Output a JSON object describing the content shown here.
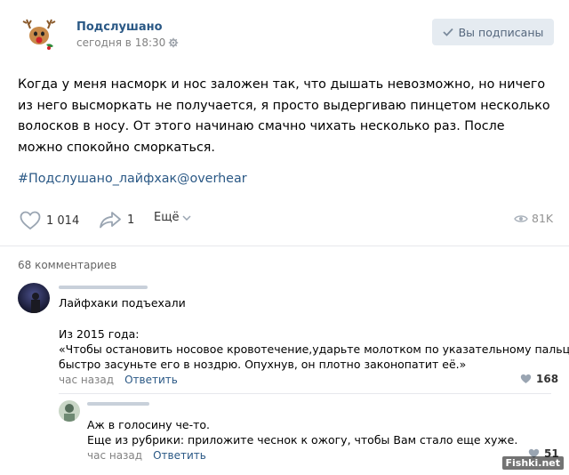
{
  "post": {
    "author": "Подслушано",
    "time": "сегодня в 18:30",
    "subscribe_label": "Вы подписаны",
    "text": "Когда у меня насморк и нос заложен так, что дышать невозможно, но ничего из него высморкать не получается, я просто выдергиваю пинцетом несколько волосков в носу. От этого начинаю смачно чихать несколько раз. После можно спокойно сморкаться.",
    "hashtag": "#Подслушано_лайфхак@overhear",
    "likes": "1 014",
    "shares": "1",
    "more_label": "Ещё",
    "views": "81K"
  },
  "comments": {
    "count_label": "68 комментариев",
    "items": [
      {
        "lines": [
          "Лайфхаки подъехали",
          "",
          "Из 2015 года:",
          "«Чтобы остановить носовое кровотечение,ударьте молотком по указательному пальцу, и",
          "быстро засуньте его в ноздрю. Опухнув, он плотно законопатит её.»"
        ],
        "time": "час назад",
        "reply_label": "Ответить",
        "likes": "168"
      },
      {
        "lines": [
          "Аж в голосину че-то.",
          "Еще из рубрики: приложите чеснок к ожогу, чтобы Вам стало еще хуже."
        ],
        "time": "час назад",
        "reply_label": "Ответить",
        "likes": "51"
      }
    ]
  },
  "watermark": "Fishki.net",
  "icons": {
    "settings": "gear-icon",
    "like": "heart-icon",
    "share": "share-arrow-icon",
    "more": "chevron-down-icon",
    "views": "eye-icon",
    "check": "check-icon"
  },
  "colors": {
    "link": "#2a5885",
    "button_bg": "#e5ebf1",
    "muted": "#828282"
  }
}
